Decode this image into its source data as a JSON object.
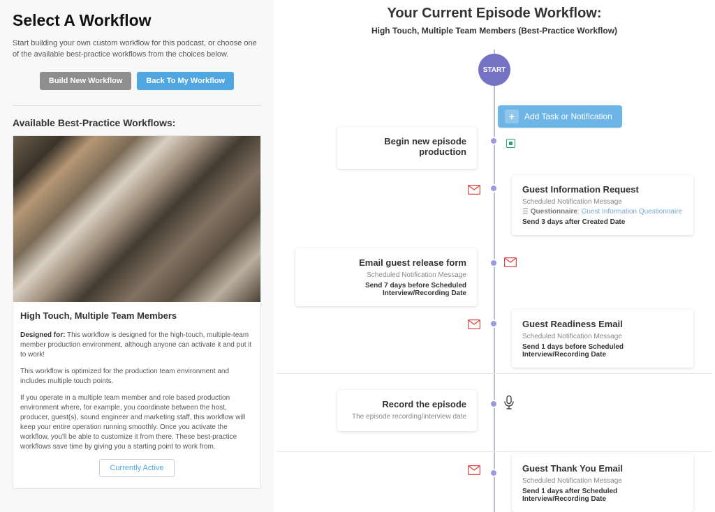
{
  "left": {
    "title": "Select A Workflow",
    "intro": "Start building your own custom workflow for this podcast, or choose one of the available best-practice workflows from the choices below.",
    "build_btn": "Build New Workflow",
    "back_btn": "Back To My Workflow",
    "section_title": "Available Best-Practice Workflows:",
    "card": {
      "title": "High Touch, Multiple Team Members",
      "para1_label": "Designed for:",
      "para1_rest": " This workflow is designed for the high-touch, multiple-team member production environment, although anyone can activate it and put it to work!",
      "para2": "This workflow is optimized for the production team environment and includes multiple touch points.",
      "para3": "If you operate in a multiple team member and role based production environment where, for example, you coordinate between the host, producer, guest(s), sound engineer and marketing staff, this workflow will keep your entire operation running smoothly. Once you activate the workflow, you'll be able to customize it from there. These best-practice workflows save time by giving you a starting point to work from.",
      "status_btn": "Currently Active"
    }
  },
  "right": {
    "heading": "Your Current Episode Workflow:",
    "subheading": "High Touch, Multiple Team Members (Best-Practice Workflow)",
    "start": "START",
    "add_btn": "Add Task or Notification",
    "events": {
      "c1": {
        "title": "Begin new episode production"
      },
      "c2": {
        "title": "Guest Information Request",
        "meta1": "Scheduled Notification Message",
        "meta2_label": "Questionnaire",
        "meta2_value": "Guest Information Questionnaire",
        "send": "Send 3 days after Created Date"
      },
      "c3": {
        "title": "Email guest release form",
        "meta1": "Scheduled Notification Message",
        "send": "Send 7 days before Scheduled Interview/Recording Date"
      },
      "c4": {
        "title": "Guest Readiness Email",
        "meta1": "Scheduled Notification Message",
        "send": "Send 1 days before Scheduled Interview/Recording Date"
      },
      "c5": {
        "title": "Record the episode",
        "note": "The episode recording/interview date"
      },
      "c6": {
        "title": "Guest Thank You Email",
        "meta1": "Scheduled Notification Message",
        "send": "Send 1 days after Scheduled Interview/Recording Date"
      }
    }
  }
}
